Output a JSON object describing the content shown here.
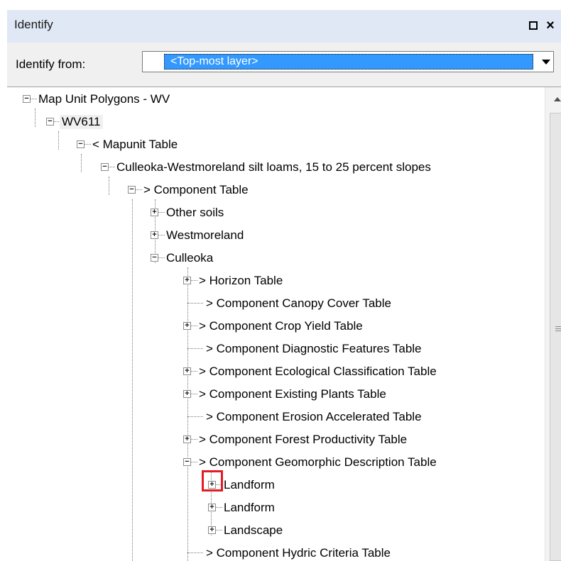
{
  "panel": {
    "title": "Identify",
    "restore_label": "□",
    "close_label": "×"
  },
  "identify_from": {
    "label": "Identify from:",
    "selected": "<Top-most layer>"
  },
  "tree": {
    "items": [
      {
        "label": "Map Unit Polygons - WV",
        "expander": "−"
      },
      {
        "label": "WV611",
        "expander": "−"
      },
      {
        "label": "< Mapunit Table",
        "expander": "−"
      },
      {
        "label": "Culleoka-Westmoreland silt loams, 15 to 25 percent slopes",
        "expander": "−"
      },
      {
        "label": "> Component Table",
        "expander": "−"
      },
      {
        "label": "Other soils",
        "expander": "+"
      },
      {
        "label": "Westmoreland",
        "expander": "+"
      },
      {
        "label": "Culleoka",
        "expander": "−"
      },
      {
        "label": "> Horizon Table",
        "expander": "+"
      },
      {
        "label": "> Component Canopy Cover Table",
        "expander": ""
      },
      {
        "label": "> Component Crop Yield Table",
        "expander": "+"
      },
      {
        "label": "> Component Diagnostic Features Table",
        "expander": ""
      },
      {
        "label": "> Component Ecological Classification Table",
        "expander": "+"
      },
      {
        "label": "> Component Existing Plants Table",
        "expander": "+"
      },
      {
        "label": "> Component Erosion Accelerated Table",
        "expander": ""
      },
      {
        "label": "> Component Forest Productivity Table",
        "expander": "+"
      },
      {
        "label": "> Component Geomorphic Description Table",
        "expander": "−"
      },
      {
        "label": "Landform",
        "expander": "+"
      },
      {
        "label": "Landform",
        "expander": "+"
      },
      {
        "label": "Landscape",
        "expander": "+"
      },
      {
        "label": "> Component Hydric Criteria Table",
        "expander": ""
      }
    ]
  },
  "colors": {
    "accent_selection": "#3399ff",
    "highlight_box": "#e31c23"
  }
}
